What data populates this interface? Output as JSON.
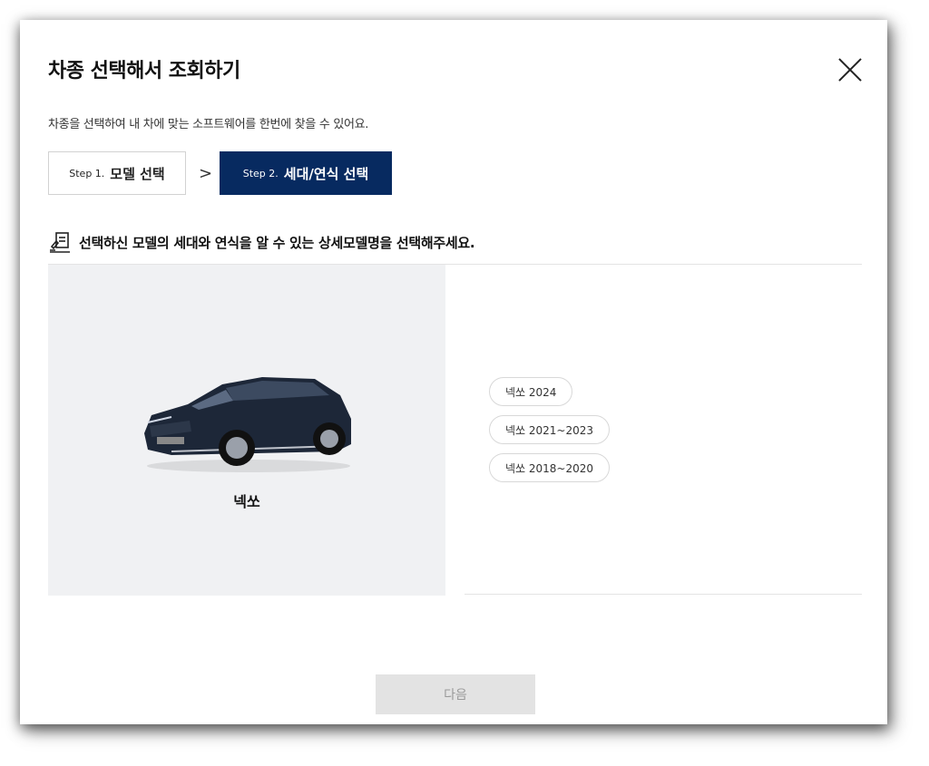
{
  "modal": {
    "title": "차종 선택해서 조회하기",
    "subtitle": "차종을 선택하여 내 차에 맞는 소프트웨어를 한번에 찾을 수 있어요."
  },
  "steps": [
    {
      "num": "Step 1.",
      "label": "모델 선택",
      "active": false
    },
    {
      "num": "Step 2.",
      "label": "세대/연식 선택",
      "active": true
    }
  ],
  "step_separator": ">",
  "guide_text": "선택하신 모델의 세대와 연식을 알 수 있는 상세모델명을 선택해주세요.",
  "selected_model": {
    "name": "넥쏘"
  },
  "generations": [
    "넥쏘 2024",
    "넥쏘 2021~2023",
    "넥쏘 2018~2020"
  ],
  "next_button": "다음",
  "colors": {
    "active_step": "#072a60",
    "panel_bg": "#f0f1f3",
    "disabled_button": "#e3e3e3"
  }
}
